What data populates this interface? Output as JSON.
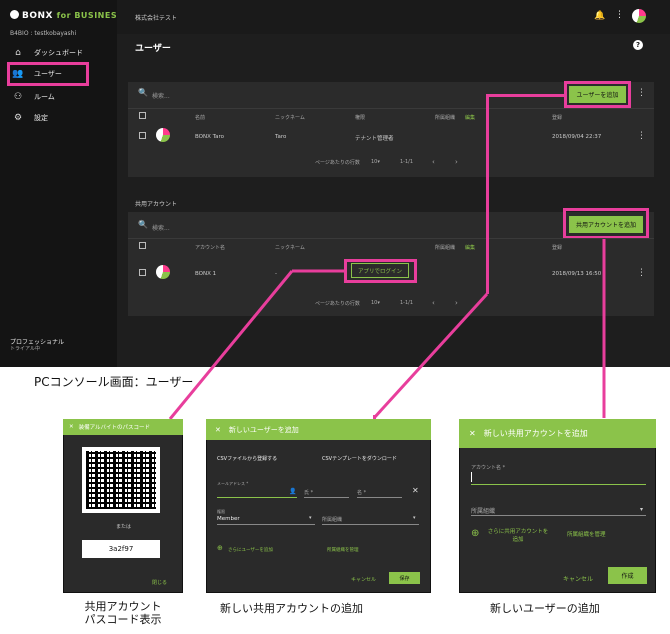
{
  "app": {
    "logo_text": "BONX",
    "logo_suffix": "for BUSINESS",
    "user_id": "B4BIO : testkobayashi",
    "company": "株式会社テスト"
  },
  "sidebar": {
    "items": [
      {
        "label": "ダッシュボード",
        "icon": "home-icon"
      },
      {
        "label": "ユーザー",
        "icon": "users-icon"
      },
      {
        "label": "ルーム",
        "icon": "room-icon"
      },
      {
        "label": "設定",
        "icon": "gear-icon"
      }
    ],
    "plan": "プロフェッショナル",
    "plan_sub": "トライアル中"
  },
  "main": {
    "title": "ユーザー",
    "users": {
      "search_placeholder": "検索...",
      "add_button": "ユーザーを追加",
      "columns": [
        "名前",
        "ニックネーム",
        "権限",
        "所属組織",
        "編集",
        "登録"
      ],
      "rows": [
        {
          "name": "BONX Taro",
          "nickname": "Taro",
          "role": "テナント管理者",
          "org": "",
          "registered": "2018/09/04 22:37"
        }
      ],
      "pagination": {
        "rows_label": "ページあたりの行数",
        "rows_value": "10",
        "range": "1-1/1"
      }
    },
    "shared": {
      "section_title": "共用アカウント",
      "search_placeholder": "検索...",
      "add_button": "共用アカウントを追加",
      "columns": [
        "アカウント名",
        "ニックネーム",
        "所属組織",
        "編集",
        "登録"
      ],
      "rows": [
        {
          "name": "BONX 1",
          "nickname": "-",
          "app_login": "アプリでログイン",
          "registered": "2018/09/13 16:50"
        }
      ],
      "pagination": {
        "rows_label": "ページあたりの行数",
        "rows_value": "10",
        "range": "1-1/1"
      }
    }
  },
  "captions": {
    "main": "PCコンソール画面：ユーザー",
    "passcode": "共用アカウント\nパスコード表示",
    "new_user": "新しい共用アカウントの追加",
    "new_shared": "新しいユーザーの追加"
  },
  "passcode_dialog": {
    "title": "装備アルバイトのパスコード",
    "or_text": "または",
    "code": "3a2f97",
    "close": "閉じる"
  },
  "new_user_dialog": {
    "title": "新しいユーザーを追加",
    "csv_register": "CSVファイルから登録する",
    "csv_template": "CSVテンプレートをダウンロード",
    "email_label": "メールアドレス *",
    "last_name_label": "氏 *",
    "first_name_label": "名 *",
    "role_label": "権限",
    "role_value": "Member",
    "org_placeholder": "所属組織",
    "add_more": "さらにユーザーを追加",
    "manage_org": "所属組織を管理",
    "cancel": "キャンセル",
    "save": "保存"
  },
  "new_shared_dialog": {
    "title": "新しい共用アカウントを追加",
    "account_label": "アカウント名 *",
    "org_placeholder": "所属組織",
    "add_more": "さらに共用アカウントを追加",
    "manage_org": "所属組織を管理",
    "cancel": "キャンセル",
    "create": "作成"
  },
  "colors": {
    "accent": "#8bc34a",
    "highlight": "#e83e9c",
    "console_bg": "#1e1e1e"
  }
}
